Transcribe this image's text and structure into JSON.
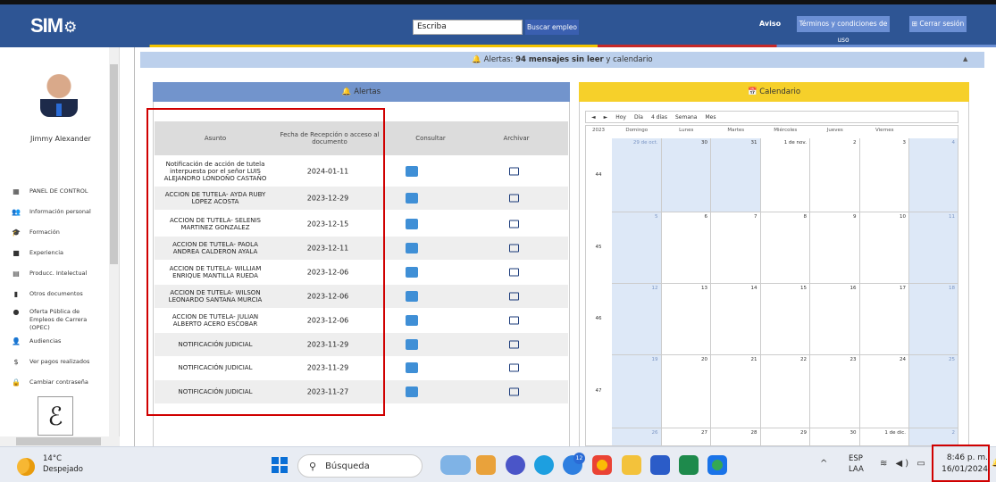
{
  "header": {
    "logo": "SIM",
    "search_value": "Escriba",
    "search_button": "Buscar empleo",
    "aviso": "Aviso",
    "terms": "Términos y condiciones de uso",
    "logout": "Cerrar sesión"
  },
  "sidebar": {
    "user_name": "Jimmy Alexander",
    "items": [
      {
        "label": "PANEL DE CONTROL",
        "icon": "dashboard-icon"
      },
      {
        "label": "Información personal",
        "icon": "people-icon"
      },
      {
        "label": "Formación",
        "icon": "graduation-cap-icon"
      },
      {
        "label": "Experiencia",
        "icon": "briefcase-icon"
      },
      {
        "label": "Producc. Intelectual",
        "icon": "book-icon"
      },
      {
        "label": "Otros documentos",
        "icon": "document-icon"
      },
      {
        "label": "Oferta Pública de Empleos de Carrera (OPEC)",
        "icon": "globe-icon"
      },
      {
        "label": "Audiencias",
        "icon": "audience-icon"
      },
      {
        "label": "Ver pagos realizados",
        "icon": "dollar-icon"
      },
      {
        "label": "Cambiar contraseña",
        "icon": "lock-icon"
      }
    ]
  },
  "alert_bar": {
    "prefix": "Alertas: ",
    "bold": "94 mensajes sin leer",
    "suffix": " y calendario"
  },
  "alerts": {
    "title": "Alertas",
    "columns": [
      "Asunto",
      "Fecha de Recepción o acceso al documento",
      "Consultar",
      "Archivar"
    ],
    "rows": [
      {
        "asunto": "Notificación de acción de tutela interpuesta por el señor LUIS ALEJANDRO LONDOÑO CASTAÑO",
        "fecha": "2024-01-11"
      },
      {
        "asunto": "ACCION DE TUTELA- AYDA RUBY LOPEZ ACOSTA",
        "fecha": "2023-12-29"
      },
      {
        "asunto": "ACCION DE TUTELA- SELENIS MARTINEZ GONZALEZ",
        "fecha": "2023-12-15"
      },
      {
        "asunto": "ACCION DE TUTELA- PAOLA ANDREA CALDERON AYALA",
        "fecha": "2023-12-11"
      },
      {
        "asunto": "ACCION DE TUTELA- WILLIAM ENRIQUE MANTILLA RUEDA",
        "fecha": "2023-12-06"
      },
      {
        "asunto": "ACCION DE TUTELA- WILSON LEONARDO SANTANA MURCIA",
        "fecha": "2023-12-06"
      },
      {
        "asunto": "ACCION DE TUTELA- JULIAN ALBERTO ACERO ESCOBAR",
        "fecha": "2023-12-06"
      },
      {
        "asunto": "NOTIFICACIÓN JUDICIAL",
        "fecha": "2023-11-29"
      },
      {
        "asunto": "NOTIFICACIÓN JUDICIAL",
        "fecha": "2023-11-29"
      },
      {
        "asunto": "NOTIFICACIÓN JUDICIAL",
        "fecha": "2023-11-27"
      }
    ]
  },
  "calendar": {
    "title": "Calendario",
    "toolbar": [
      "◄",
      "►",
      "Hoy",
      "Día",
      "4 días",
      "Semana",
      "Mes"
    ],
    "year": "2023",
    "days": [
      "Domingo",
      "Lunes",
      "Martes",
      "Miércoles",
      "Jueves",
      "Viernes"
    ],
    "weeks": [
      {
        "num": "44",
        "dates": [
          "29 de oct.",
          "30",
          "31",
          "1 de nov.",
          "2",
          "3",
          "4"
        ]
      },
      {
        "num": "45",
        "dates": [
          "5",
          "6",
          "7",
          "8",
          "9",
          "10",
          "11"
        ]
      },
      {
        "num": "46",
        "dates": [
          "12",
          "13",
          "14",
          "15",
          "16",
          "17",
          "18"
        ]
      },
      {
        "num": "47",
        "dates": [
          "19",
          "20",
          "21",
          "22",
          "23",
          "24",
          "25"
        ]
      },
      {
        "num": "",
        "dates": [
          "26",
          "27",
          "28",
          "29",
          "30",
          "1 de dic.",
          "2"
        ]
      }
    ]
  },
  "taskbar": {
    "temp": "14°C",
    "condition": "Despejado",
    "search": "Búsqueda",
    "lang1": "ESP",
    "lang2": "LAA",
    "time": "8:46 p. m.",
    "date": "16/01/2024",
    "badge": "12"
  }
}
